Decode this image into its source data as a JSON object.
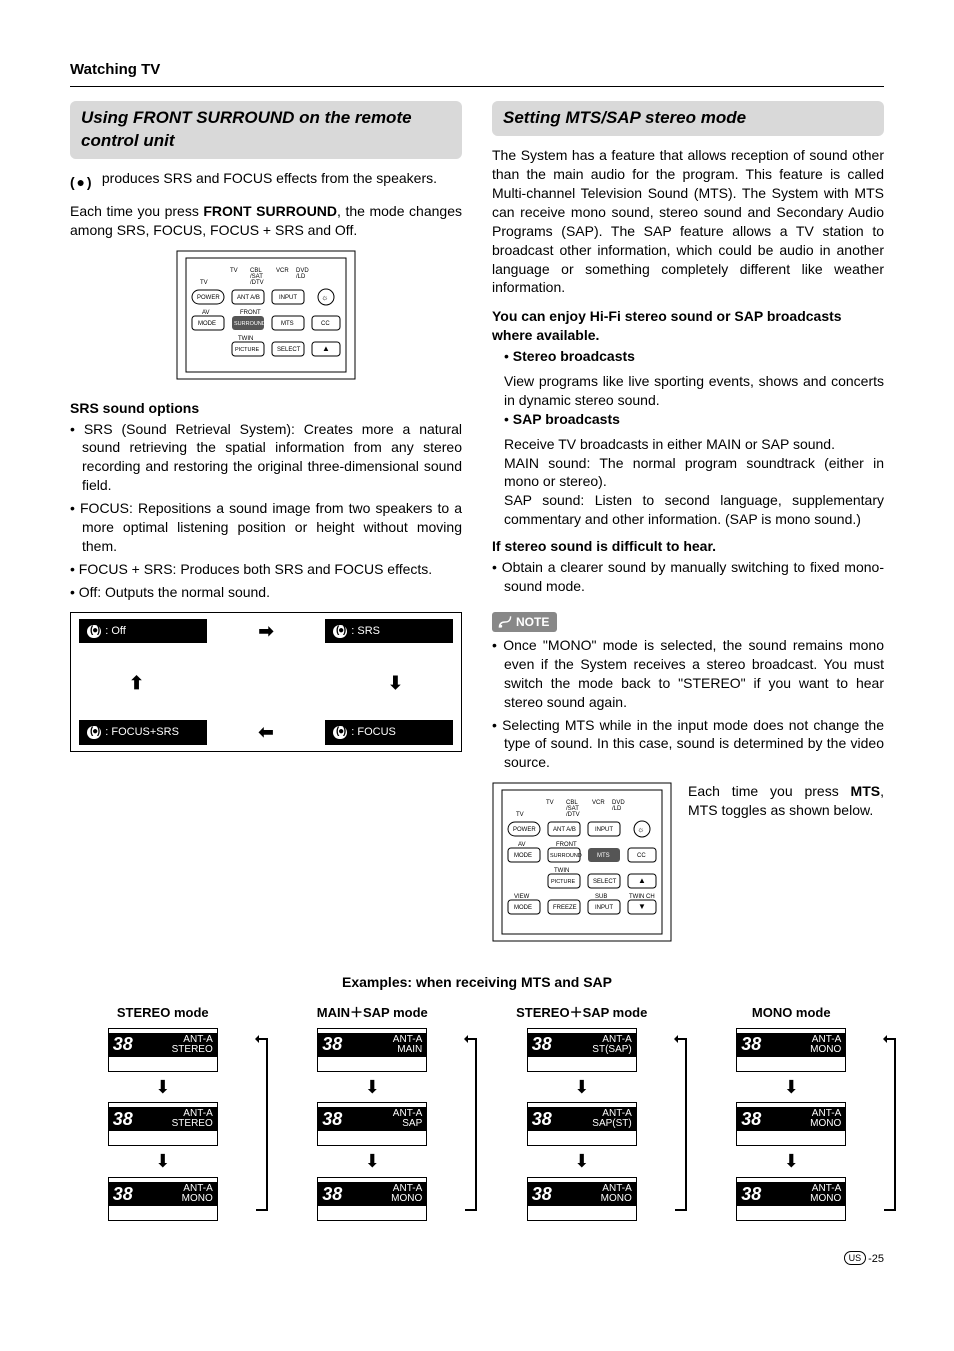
{
  "header": "Watching TV",
  "left": {
    "title": "Using FRONT SURROUND on the remote control unit",
    "intro_pre": " produces SRS and FOCUS effects from the speakers.",
    "intro2_a": "Each time you press ",
    "intro2_b": "FRONT SURROUND",
    "intro2_c": ", the mode changes among SRS, FOCUS, FOCUS + SRS and Off.",
    "subhead": "SRS sound options",
    "bullets": [
      "SRS (Sound Retrieval System): Creates more a natural sound retrieving the spatial information from any stereo recording and restoring the original three-dimensional sound field.",
      "FOCUS: Repositions a sound image from two speakers to a more optimal listening position or height without moving them.",
      "FOCUS + SRS: Produces both SRS and FOCUS effects.",
      "Off: Outputs the normal sound."
    ],
    "flow": {
      "off": ": Off",
      "srs": ": SRS",
      "focus_srs": ": FOCUS+SRS",
      "focus": ": FOCUS"
    }
  },
  "right": {
    "title": "Setting MTS/SAP stereo mode",
    "p1": "The System has a feature that allows reception of sound other than the main audio for the program. This feature is called Multi-channel Television Sound (MTS). The System with MTS can receive mono sound, stereo sound and Secondary Audio Programs (SAP). The SAP feature allows a TV station to broadcast other information, which could be audio in another language or something completely different like weather information.",
    "sub1": "You can enjoy Hi-Fi stereo sound or SAP broadcasts where available.",
    "stereo_h": "Stereo broadcasts",
    "stereo_b": "View programs like live sporting events, shows and concerts in dynamic stereo sound.",
    "sap_h": "SAP broadcasts",
    "sap_b1": "Receive TV broadcasts in either MAIN or SAP sound.",
    "sap_b2": "MAIN sound: The normal program soundtrack (either in mono or stereo).",
    "sap_b3": "SAP sound: Listen to second language, supplementary commentary and other information. (SAP is mono sound.)",
    "sub2": "If stereo sound is difficult to hear.",
    "sub2_b": "Obtain a clearer sound by manually switching to fixed mono-sound mode.",
    "note_label": "NOTE",
    "notes": [
      "Once \"MONO\" mode is selected, the sound remains mono even if the System receives a stereo broadcast. You must switch the mode back to \"STEREO\" if you want to hear stereo sound again.",
      "Selecting MTS while in the input mode does not change the type of sound. In this case, sound is determined by the video source."
    ],
    "mts_text_a": "Each time you press ",
    "mts_text_b": "MTS",
    "mts_text_c": ", MTS toggles as shown below."
  },
  "examples": {
    "title": "Examples: when receiving MTS and SAP",
    "ch": "38",
    "ant": "ANT-A",
    "cols": [
      {
        "title": "STEREO mode",
        "modes": [
          "STEREO",
          "STEREO",
          "MONO"
        ]
      },
      {
        "title": "MAIN＋SAP mode",
        "modes": [
          "MAIN",
          "SAP",
          "MONO"
        ]
      },
      {
        "title": "STEREO＋SAP mode",
        "modes": [
          "ST(SAP)",
          "SAP(ST)",
          "MONO"
        ]
      },
      {
        "title": "MONO mode",
        "modes": [
          "MONO",
          "MONO",
          "MONO"
        ]
      }
    ]
  },
  "remote_labels": {
    "tv": "TV",
    "cbl": "CBL",
    "sat": "/SAT",
    "dtv": "/DTV",
    "vcr": "VCR",
    "dvd": "DVD",
    "ld": "/LD",
    "power": "POWER",
    "anta": "ANT A/B",
    "input": "INPUT",
    "av": "AV",
    "front": "FRONT",
    "mode": "MODE",
    "surround": "SURROUND",
    "mts": "MTS",
    "cc": "CC",
    "twin": "TWIN",
    "picture": "PICTURE",
    "select": "SELECT",
    "view": "VIEW",
    "freeze": "FREEZE",
    "sub": "SUB",
    "twinch": "TWIN CH",
    "input2": "INPUT"
  },
  "page": {
    "region": "US",
    "num": "-25"
  }
}
